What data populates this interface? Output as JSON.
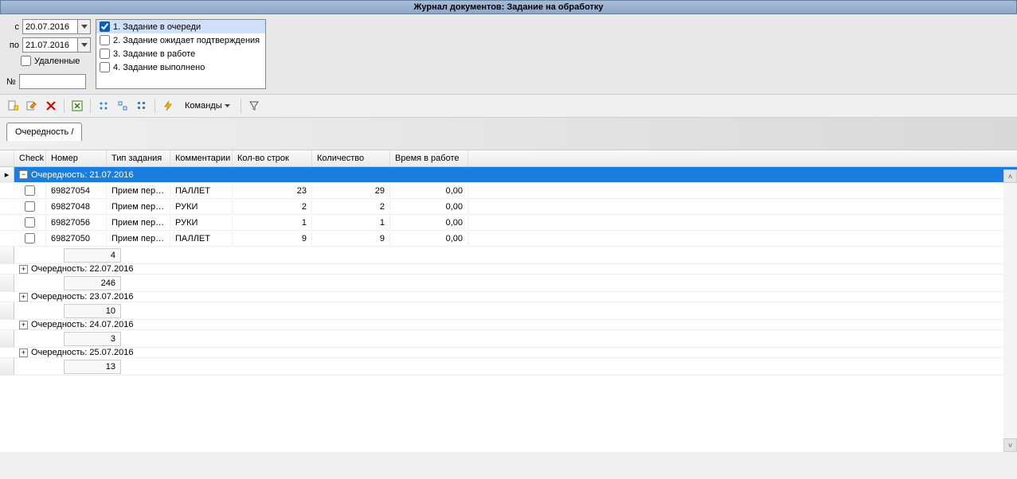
{
  "title": "Журнал документов: Задание на обработку",
  "filters": {
    "from_label": "с",
    "to_label": "по",
    "from_date": "20.07.2016",
    "to_date": "21.07.2016",
    "deleted_label": "Удаленные",
    "num_label": "№",
    "num_value": ""
  },
  "statuses": {
    "items": [
      {
        "label": "1. Задание в очереди",
        "checked": true,
        "selected": true
      },
      {
        "label": "2. Задание ожидает подтверждения",
        "checked": false,
        "selected": false
      },
      {
        "label": "3. Задание в работе",
        "checked": false,
        "selected": false
      },
      {
        "label": "4. Задание выполнено",
        "checked": false,
        "selected": false
      }
    ]
  },
  "toolbar": {
    "commands_label": "Команды"
  },
  "tab": {
    "label": "Очередность /"
  },
  "columns": {
    "check": "Check",
    "number": "Номер",
    "type": "Тип задания",
    "comments": "Комментарии",
    "lines": "Кол-во строк",
    "qty": "Количество",
    "time": "Время в работе"
  },
  "groups": [
    {
      "label": "Очередность: 21.07.2016",
      "expanded": true,
      "active": true,
      "rows": [
        {
          "number": "69827054",
          "type": "Прием перем…",
          "comments": "ПАЛЛЕТ",
          "lines": "23",
          "qty": "29",
          "time": "0,00"
        },
        {
          "number": "69827048",
          "type": "Прием перем…",
          "comments": "РУКИ",
          "lines": "2",
          "qty": "2",
          "time": "0,00"
        },
        {
          "number": "69827056",
          "type": "Прием перем…",
          "comments": "РУКИ",
          "lines": "1",
          "qty": "1",
          "time": "0,00"
        },
        {
          "number": "69827050",
          "type": "Прием перем…",
          "comments": "ПАЛЛЕТ",
          "lines": "9",
          "qty": "9",
          "time": "0,00"
        }
      ],
      "summary": "4"
    },
    {
      "label": "Очередность: 22.07.2016",
      "expanded": false,
      "summary": "246"
    },
    {
      "label": "Очередность: 23.07.2016",
      "expanded": false,
      "summary": "10"
    },
    {
      "label": "Очередность: 24.07.2016",
      "expanded": false,
      "summary": "3"
    },
    {
      "label": "Очередность: 25.07.2016",
      "expanded": false,
      "summary": "13"
    }
  ]
}
